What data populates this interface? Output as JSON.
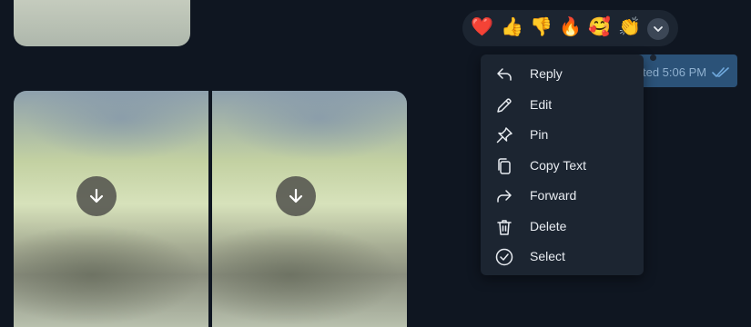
{
  "message": {
    "time_text": "ted 5:06 PM"
  },
  "reactions": [
    {
      "name": "heart",
      "glyph": "❤️"
    },
    {
      "name": "thumbs-up",
      "glyph": "👍"
    },
    {
      "name": "thumbs-down",
      "glyph": "👎"
    },
    {
      "name": "fire",
      "glyph": "🔥"
    },
    {
      "name": "smiling-face-with-hearts",
      "glyph": "🥰"
    },
    {
      "name": "clapping-hands",
      "glyph": "👏"
    }
  ],
  "context_menu": {
    "items": [
      {
        "label": "Reply",
        "icon": "reply-icon"
      },
      {
        "label": "Edit",
        "icon": "pencil-icon"
      },
      {
        "label": "Pin",
        "icon": "pin-icon"
      },
      {
        "label": "Copy Text",
        "icon": "copy-icon"
      },
      {
        "label": "Forward",
        "icon": "forward-icon"
      },
      {
        "label": "Delete",
        "icon": "trash-icon"
      },
      {
        "label": "Select",
        "icon": "check-circle-icon"
      }
    ]
  },
  "colors": {
    "background": "#0f1621",
    "menu_background": "#1c2531",
    "outgoing_bubble": "#2b5278",
    "menu_text": "#e8ecf1"
  }
}
